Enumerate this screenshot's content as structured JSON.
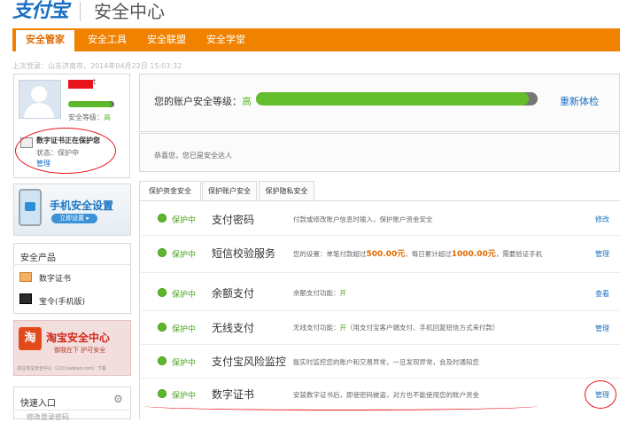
{
  "header": {
    "logo_text": "支付宝",
    "title": "安全中心"
  },
  "nav": {
    "tabs": [
      "安全管家",
      "安全工具",
      "安全联盟",
      "安全学堂"
    ],
    "active": 0
  },
  "last_login": "上次登录：山东济南市，2014年04月22日 15:03:32",
  "user": {
    "name_suffix": "t",
    "level_label": "安全等级：",
    "level_value": "高",
    "level_fraction": 0.95
  },
  "cert_notice": {
    "title": "数字证书正在保护您",
    "status": "状态：保护中",
    "manage": "管理"
  },
  "phone_promo": {
    "title": "手机安全设置",
    "button": "立即设置 ▸"
  },
  "products": {
    "title": "安全产品",
    "items": [
      "数字证书",
      "宝令(手机版)"
    ]
  },
  "taobao": {
    "icon": "淘",
    "title": "淘宝安全中心",
    "slogan": "御我在下   护可安全",
    "footer": "前往淘宝安全中心（110.taobao.com）下载"
  },
  "quick_entry": {
    "title": "快速入口",
    "gear": "⚙",
    "item": "修改登录密码"
  },
  "score": {
    "label": "您的账户安全等级：",
    "level": "高",
    "fraction": 0.97,
    "recheck": "重新体检"
  },
  "congrats": "恭喜您，您已是安全达人",
  "section_tabs": [
    "保护资金安全",
    "保护账户安全",
    "保护隐私安全"
  ],
  "rows": [
    {
      "status": "保护中",
      "name": "支付密码",
      "desc": "付款或修改账户信息时输入，保护账户资金安全",
      "action": "修改"
    },
    {
      "status": "保护中",
      "name": "短信校验服务",
      "desc_pre": "您的设置：单笔付款超过",
      "amt1": "500.00元",
      "desc_mid": "，每日累计超过",
      "amt2": "1000.00元",
      "desc_post": "，需要验证手机",
      "action": "管理"
    },
    {
      "status": "保护中",
      "name": "余额支付",
      "desc_pre": "余额支付功能：",
      "on": "开",
      "desc_post": "",
      "action": "查看"
    },
    {
      "status": "保护中",
      "name": "无线支付",
      "desc_pre": "无线支付功能：",
      "on": "开",
      "desc_post": "（用支付宝客户端支付、手机回复短信方式来付款）",
      "action": "管理"
    },
    {
      "status": "保护中",
      "name": "支付宝风险监控",
      "desc": "能实时监控您的账户和交易异常，一旦发现异常，会及时通知您",
      "action": ""
    },
    {
      "status": "保护中",
      "name": "数字证书",
      "desc": "安装数字证书后，即使密码被盗，对方也不能使用您的账户资金",
      "action": "管理"
    }
  ],
  "colors": {
    "brand_orange": "#f08200",
    "link_blue": "#1a6fc4",
    "safe_green": "#5cb82a",
    "annotation_red": "#e8141c"
  }
}
